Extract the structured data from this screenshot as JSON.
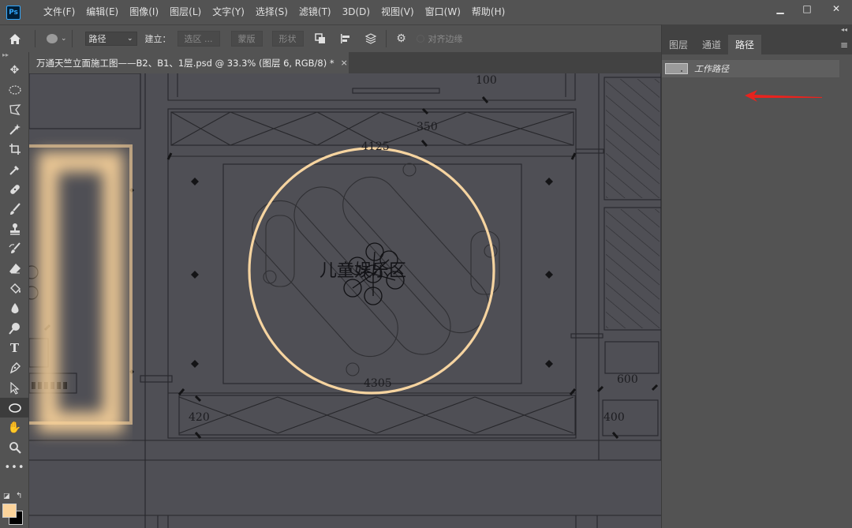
{
  "app": {
    "logo_text": "Ps",
    "menu": [
      "文件(F)",
      "编辑(E)",
      "图像(I)",
      "图层(L)",
      "文字(Y)",
      "选择(S)",
      "滤镜(T)",
      "3D(D)",
      "视图(V)",
      "窗口(W)",
      "帮助(H)"
    ],
    "window_controls": {
      "minimize": "▁",
      "maximize": "□",
      "close": "✕"
    }
  },
  "options_bar": {
    "mode_select": "路径",
    "build_label": "建立：",
    "selection_btn": "选区 ...",
    "mask_btn": "蒙版",
    "shape_btn": "形状",
    "align_edges_label": "对齐边缘"
  },
  "document": {
    "tab_title": "万通天竺立面施工图——B2、B1、1层.psd @ 33.3% (图层 6, RGB/8) *",
    "close_icon": "×"
  },
  "drawing": {
    "dim_top": "100",
    "dim_350": "350",
    "dim_4125": "4125",
    "area_label": "儿童娱乐区",
    "dim_4305": "4305",
    "dim_420": "420",
    "dim_600": "600",
    "dim_400": "400"
  },
  "panels": {
    "tabs": [
      "图层",
      "通道",
      "路径"
    ],
    "active_tab": "路径",
    "paths": [
      {
        "name": "工作路径"
      }
    ]
  },
  "colors": {
    "foreground": "#fcd49b",
    "background": "#000000",
    "path_ring": "#f6d4a0",
    "annotation_arrow": "#e8231e"
  }
}
